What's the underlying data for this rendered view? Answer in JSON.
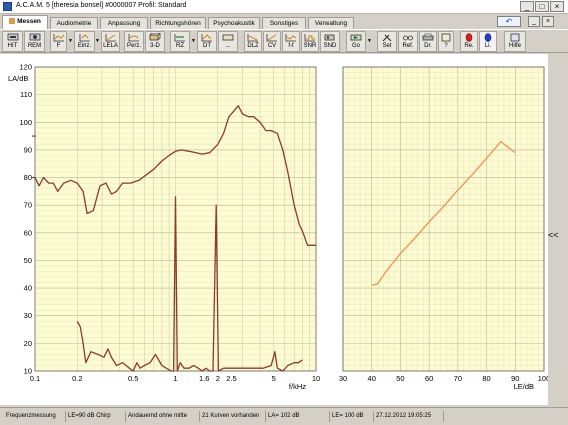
{
  "window": {
    "title": "A.C.A.M. 5 [theresia bonsel] #0000007  Profil: Standard",
    "minimize": "_",
    "maximize": "□",
    "close": "×"
  },
  "tabs": [
    {
      "label": "Messen",
      "active": true
    },
    {
      "label": "Audiometrie",
      "active": false
    },
    {
      "label": "Anpassung",
      "active": false
    },
    {
      "label": "Richtungshören",
      "active": false
    },
    {
      "label": "Psychoakustik",
      "active": false
    },
    {
      "label": "Sonstiges",
      "active": false
    },
    {
      "label": "Verwaltung",
      "active": false
    }
  ],
  "nav": {
    "back": "↶",
    "min": "_",
    "close": "×"
  },
  "toolbar": {
    "buttons": [
      {
        "label": "HIT",
        "icon": "hit-icon"
      },
      {
        "label": "REM",
        "icon": "rem-icon"
      },
      {
        "label": "F",
        "icon": "frequency-icon"
      },
      {
        "label": "Einz.",
        "icon": "single-icon"
      },
      {
        "label": "LELA",
        "icon": "lela-icon"
      },
      {
        "label": "Perz.",
        "icon": "percentile-icon"
      },
      {
        "label": "3-D",
        "icon": "3d-icon"
      },
      {
        "label": "RZ",
        "icon": "rz-icon"
      },
      {
        "label": "DT",
        "icon": "dt-icon"
      },
      {
        "label": "...",
        "icon": "more-icon"
      },
      {
        "label": "DLZ",
        "icon": "dlz-icon"
      },
      {
        "label": "CV",
        "icon": "cv-icon"
      },
      {
        "label": "f-f",
        "icon": "ff-icon"
      },
      {
        "label": "SNR",
        "icon": "snr-icon"
      },
      {
        "label": "SND",
        "icon": "snd-icon"
      },
      {
        "label": "Go",
        "icon": "go-icon"
      },
      {
        "label": "Set",
        "icon": "tools-icon"
      },
      {
        "label": "Ref.",
        "icon": "glasses-icon"
      },
      {
        "label": "Dr.",
        "icon": "printer-icon"
      },
      {
        "label": "?",
        "icon": "help-question-icon"
      },
      {
        "label": "Re.",
        "icon": "right-ear-icon"
      },
      {
        "label": "Li.",
        "icon": "left-ear-icon"
      },
      {
        "label": "Hilfe",
        "icon": "help-book-icon"
      }
    ]
  },
  "side_toggle": "<<",
  "chart_data": [
    {
      "type": "line",
      "ylabel": "LA/dB",
      "xlabel": "f/kHz",
      "x_scale": "log",
      "xlim": [
        0.1,
        10
      ],
      "ylim": [
        10,
        120
      ],
      "y_ticks": [
        10,
        20,
        30,
        40,
        50,
        60,
        70,
        80,
        90,
        100,
        110,
        120
      ],
      "x_tick_labels": [
        {
          "value": 0.1,
          "label": "0.1"
        },
        {
          "value": 0.2,
          "label": "0.2"
        },
        {
          "value": 0.5,
          "label": "0.5"
        },
        {
          "value": 1,
          "label": "1"
        },
        {
          "value": 1.6,
          "label": "1.6"
        },
        {
          "value": 2,
          "label": "2"
        },
        {
          "value": 2.5,
          "label": "2.5"
        },
        {
          "value": 5,
          "label": "5"
        },
        {
          "value": 10,
          "label": "10"
        }
      ],
      "grid": true,
      "series": [
        {
          "color": "#8b3a2f",
          "points": [
            [
              0.1,
              80
            ],
            [
              0.107,
              77
            ],
            [
              0.115,
              80
            ],
            [
              0.125,
              78
            ],
            [
              0.135,
              78
            ],
            [
              0.145,
              75
            ],
            [
              0.16,
              78
            ],
            [
              0.18,
              79
            ],
            [
              0.2,
              78
            ],
            [
              0.22,
              75
            ],
            [
              0.235,
              67
            ],
            [
              0.26,
              68
            ],
            [
              0.29,
              77
            ],
            [
              0.32,
              78
            ],
            [
              0.35,
              74
            ],
            [
              0.38,
              75
            ],
            [
              0.42,
              78
            ],
            [
              0.48,
              78
            ],
            [
              0.55,
              79
            ],
            [
              0.62,
              81
            ],
            [
              0.7,
              83
            ],
            [
              0.8,
              86
            ],
            [
              0.9,
              88
            ],
            [
              1.0,
              89.5
            ],
            [
              1.1,
              90
            ],
            [
              1.25,
              89.5
            ],
            [
              1.4,
              89
            ],
            [
              1.55,
              88.5
            ],
            [
              1.75,
              89
            ],
            [
              2.0,
              92
            ],
            [
              2.2,
              96
            ],
            [
              2.4,
              102
            ],
            [
              2.6,
              104
            ],
            [
              2.8,
              106
            ],
            [
              3.0,
              103
            ],
            [
              3.3,
              102
            ],
            [
              3.6,
              102
            ],
            [
              4.0,
              100
            ],
            [
              4.4,
              97
            ],
            [
              4.8,
              97
            ],
            [
              5.3,
              96
            ],
            [
              5.8,
              90
            ],
            [
              6.3,
              82
            ],
            [
              7.0,
              70
            ],
            [
              7.6,
              63
            ],
            [
              8.1,
              60
            ],
            [
              8.7,
              55.5
            ],
            [
              10,
              55.5
            ]
          ]
        },
        {
          "color": "#8b3a2f",
          "points": [
            [
              0.2,
              28
            ],
            [
              0.21,
              26
            ],
            [
              0.22,
              20
            ],
            [
              0.23,
              13
            ],
            [
              0.25,
              17
            ],
            [
              0.28,
              16
            ],
            [
              0.31,
              15
            ],
            [
              0.33,
              18
            ],
            [
              0.35,
              15
            ],
            [
              0.38,
              12
            ],
            [
              0.42,
              13
            ],
            [
              0.47,
              11
            ],
            [
              0.5,
              10
            ],
            [
              0.53,
              13
            ],
            [
              0.56,
              11
            ],
            [
              0.6,
              12
            ],
            [
              0.66,
              13
            ],
            [
              0.72,
              16
            ],
            [
              0.8,
              12
            ],
            [
              0.86,
              11
            ],
            [
              0.93,
              10
            ],
            [
              0.97,
              10
            ],
            [
              1.0,
              73
            ],
            [
              1.03,
              10
            ],
            [
              1.08,
              13
            ],
            [
              1.15,
              11
            ],
            [
              1.25,
              11
            ],
            [
              1.35,
              12
            ],
            [
              1.45,
              11
            ],
            [
              1.55,
              10
            ],
            [
              1.65,
              11
            ],
            [
              1.75,
              10
            ],
            [
              1.85,
              10
            ],
            [
              1.95,
              70
            ],
            [
              2.02,
              10
            ],
            [
              2.2,
              11
            ],
            [
              2.4,
              11
            ],
            [
              2.7,
              11
            ],
            [
              3.1,
              11
            ],
            [
              3.6,
              11
            ],
            [
              4.2,
              11
            ],
            [
              4.8,
              12
            ],
            [
              5.1,
              17
            ],
            [
              5.3,
              11
            ],
            [
              5.8,
              10
            ],
            [
              6.3,
              12
            ],
            [
              7.0,
              13
            ],
            [
              7.5,
              13
            ],
            [
              8.0,
              14
            ]
          ]
        }
      ]
    },
    {
      "type": "line",
      "ylabel": "",
      "xlabel": "LE/dB",
      "xlim": [
        30,
        100
      ],
      "ylim": [
        10,
        120
      ],
      "x_ticks": [
        30,
        40,
        50,
        60,
        70,
        80,
        90,
        100
      ],
      "grid": true,
      "series": [
        {
          "color": "#e8a060",
          "points": [
            [
              40,
              41
            ],
            [
              42,
              41.5
            ],
            [
              45,
              46
            ],
            [
              50,
              52.5
            ],
            [
              55,
              58
            ],
            [
              60,
              64
            ],
            [
              65,
              69.5
            ],
            [
              70,
              75.5
            ],
            [
              75,
              81
            ],
            [
              80,
              87
            ],
            [
              85,
              93
            ],
            [
              90,
              89
            ]
          ]
        }
      ]
    }
  ],
  "statusbar": [
    {
      "text": "Frequenzmessung"
    },
    {
      "text": "LE=90 dB Chirp"
    },
    {
      "text": "Andauernd ohne mitte"
    },
    {
      "text": "21 Kurven vorhanden"
    },
    {
      "text": "LA= 102 dB"
    },
    {
      "text": "LE= 100 dB"
    },
    {
      "text": "27.12.2012 19:05:25"
    }
  ]
}
